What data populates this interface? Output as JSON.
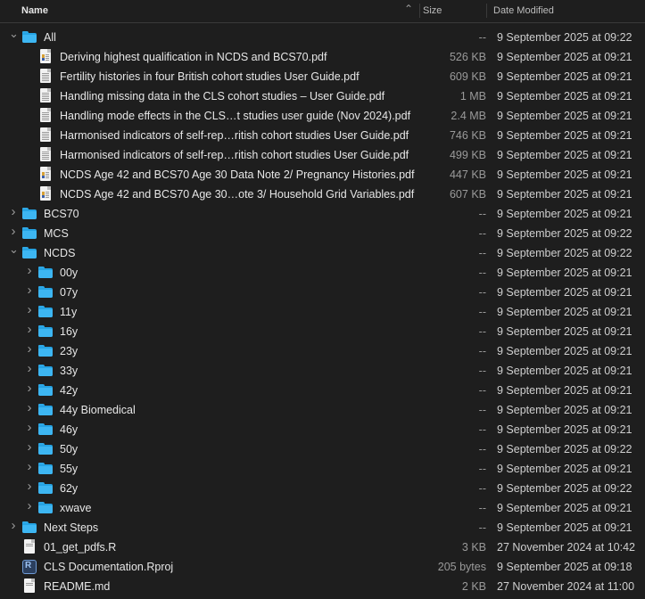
{
  "header": {
    "name_label": "Name",
    "size_label": "Size",
    "date_label": "Date Modified",
    "sort_icon": "chevron-up-icon"
  },
  "rows": [
    {
      "level": 0,
      "kind": "folder",
      "expanded": true,
      "name": "All",
      "size": "--",
      "date": "9 September 2025 at 09:22"
    },
    {
      "level": 1,
      "kind": "pdf-color",
      "name": "Deriving highest qualification in NCDS and BCS70.pdf",
      "size": "526 KB",
      "date": "9 September 2025 at 09:21"
    },
    {
      "level": 1,
      "kind": "pdf",
      "name": "Fertility histories in four British cohort studies User Guide.pdf",
      "size": "609 KB",
      "date": "9 September 2025 at 09:21"
    },
    {
      "level": 1,
      "kind": "pdf",
      "name": "Handling missing data in the CLS cohort studies – User Guide.pdf",
      "size": "1 MB",
      "date": "9 September 2025 at 09:21"
    },
    {
      "level": 1,
      "kind": "pdf",
      "name": "Handling mode effects in the CLS…t studies user guide (Nov 2024).pdf",
      "size": "2.4 MB",
      "date": "9 September 2025 at 09:21"
    },
    {
      "level": 1,
      "kind": "pdf",
      "name": "Harmonised indicators of self-rep…ritish cohort studies User Guide.pdf",
      "size": "746 KB",
      "date": "9 September 2025 at 09:21"
    },
    {
      "level": 1,
      "kind": "pdf",
      "name": "Harmonised indicators of self-rep…ritish cohort studies User Guide.pdf",
      "size": "499 KB",
      "date": "9 September 2025 at 09:21"
    },
    {
      "level": 1,
      "kind": "pdf-color",
      "name": "NCDS Age 42 and BCS70 Age 30 Data Note 2/ Pregnancy Histories.pdf",
      "size": "447 KB",
      "date": "9 September 2025 at 09:21"
    },
    {
      "level": 1,
      "kind": "pdf-color",
      "name": "NCDS Age 42 and BCS70 Age 30…ote 3/ Household Grid Variables.pdf",
      "size": "607 KB",
      "date": "9 September 2025 at 09:21"
    },
    {
      "level": 0,
      "kind": "folder",
      "expanded": false,
      "name": "BCS70",
      "size": "--",
      "date": "9 September 2025 at 09:21"
    },
    {
      "level": 0,
      "kind": "folder",
      "expanded": false,
      "name": "MCS",
      "size": "--",
      "date": "9 September 2025 at 09:22"
    },
    {
      "level": 0,
      "kind": "folder",
      "expanded": true,
      "name": "NCDS",
      "size": "--",
      "date": "9 September 2025 at 09:22"
    },
    {
      "level": 1,
      "kind": "folder",
      "expanded": false,
      "name": "00y",
      "size": "--",
      "date": "9 September 2025 at 09:21"
    },
    {
      "level": 1,
      "kind": "folder",
      "expanded": false,
      "name": "07y",
      "size": "--",
      "date": "9 September 2025 at 09:21"
    },
    {
      "level": 1,
      "kind": "folder",
      "expanded": false,
      "name": "11y",
      "size": "--",
      "date": "9 September 2025 at 09:21"
    },
    {
      "level": 1,
      "kind": "folder",
      "expanded": false,
      "name": "16y",
      "size": "--",
      "date": "9 September 2025 at 09:21"
    },
    {
      "level": 1,
      "kind": "folder",
      "expanded": false,
      "name": "23y",
      "size": "--",
      "date": "9 September 2025 at 09:21"
    },
    {
      "level": 1,
      "kind": "folder",
      "expanded": false,
      "name": "33y",
      "size": "--",
      "date": "9 September 2025 at 09:21"
    },
    {
      "level": 1,
      "kind": "folder",
      "expanded": false,
      "name": "42y",
      "size": "--",
      "date": "9 September 2025 at 09:21"
    },
    {
      "level": 1,
      "kind": "folder",
      "expanded": false,
      "name": "44y Biomedical",
      "size": "--",
      "date": "9 September 2025 at 09:21"
    },
    {
      "level": 1,
      "kind": "folder",
      "expanded": false,
      "name": "46y",
      "size": "--",
      "date": "9 September 2025 at 09:21"
    },
    {
      "level": 1,
      "kind": "folder",
      "expanded": false,
      "name": "50y",
      "size": "--",
      "date": "9 September 2025 at 09:22"
    },
    {
      "level": 1,
      "kind": "folder",
      "expanded": false,
      "name": "55y",
      "size": "--",
      "date": "9 September 2025 at 09:21"
    },
    {
      "level": 1,
      "kind": "folder",
      "expanded": false,
      "name": "62y",
      "size": "--",
      "date": "9 September 2025 at 09:22"
    },
    {
      "level": 1,
      "kind": "folder",
      "expanded": false,
      "name": "xwave",
      "size": "--",
      "date": "9 September 2025 at 09:21"
    },
    {
      "level": 0,
      "kind": "folder",
      "expanded": false,
      "name": "Next Steps",
      "size": "--",
      "date": "9 September 2025 at 09:21"
    },
    {
      "level": 0,
      "kind": "rfile",
      "name": "01_get_pdfs.R",
      "size": "3 KB",
      "date": "27 November 2024 at 10:42"
    },
    {
      "level": 0,
      "kind": "rproj",
      "name": "CLS Documentation.Rproj",
      "size": "205 bytes",
      "date": "9 September 2025 at 09:18"
    },
    {
      "level": 0,
      "kind": "md",
      "name": "README.md",
      "size": "2 KB",
      "date": "27 November 2024 at 11:00"
    }
  ]
}
